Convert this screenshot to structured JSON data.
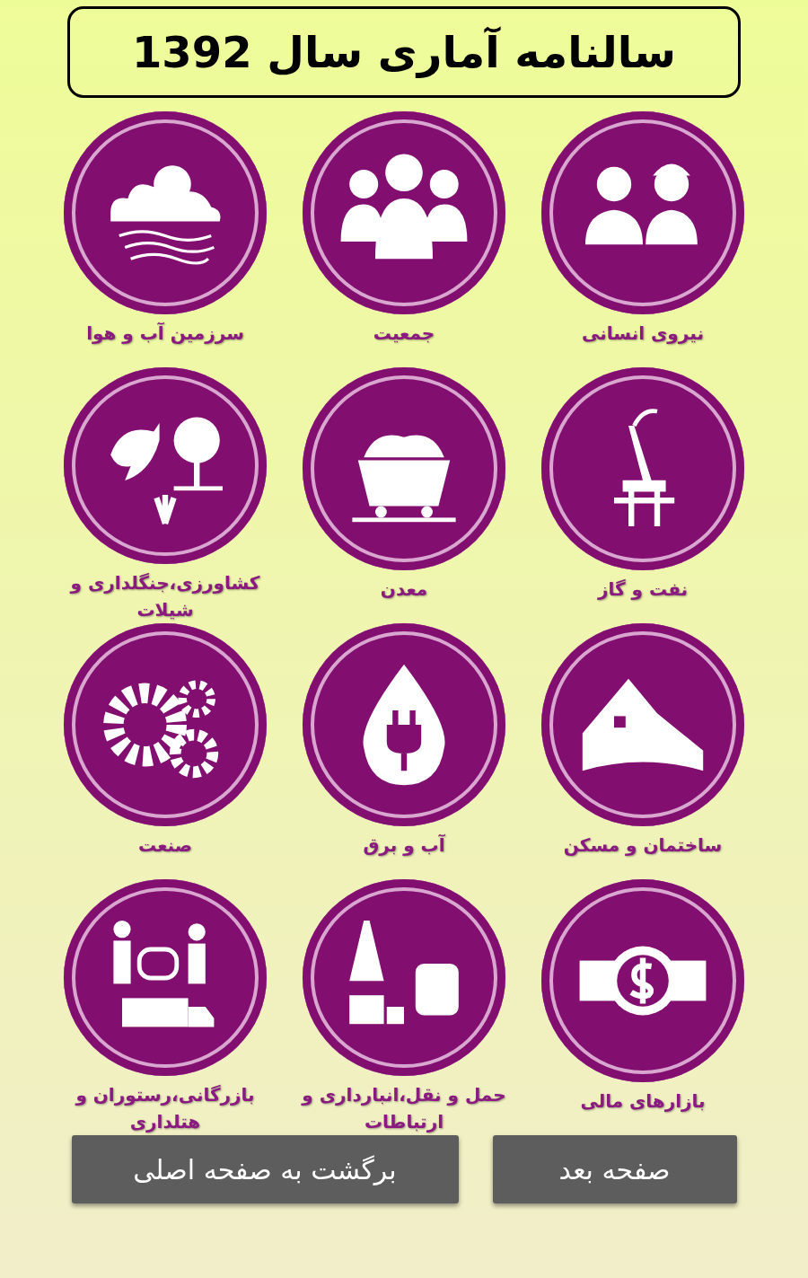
{
  "title": "سالنامه آماری سال 1392",
  "tiles": [
    {
      "label": "نیروی انسانی"
    },
    {
      "label": "جمعیت"
    },
    {
      "label": "سرزمین آب و هوا"
    },
    {
      "label": "نفت و گاز"
    },
    {
      "label": "معدن"
    },
    {
      "label": "کشاورزی،جنگلداری و شیلات"
    },
    {
      "label": "ساختمان و مسکن"
    },
    {
      "label": "آب و برق"
    },
    {
      "label": "صنعت"
    },
    {
      "label": "بازارهای مالی"
    },
    {
      "label": "حمل و نقل،انبارداری و ارتباطات"
    },
    {
      "label": "بازرگانی،رستوران و هتلداری"
    }
  ],
  "buttons": [
    {
      "label": "صفحه بعد"
    },
    {
      "label": "برگشت به صفحه اصلی"
    }
  ]
}
